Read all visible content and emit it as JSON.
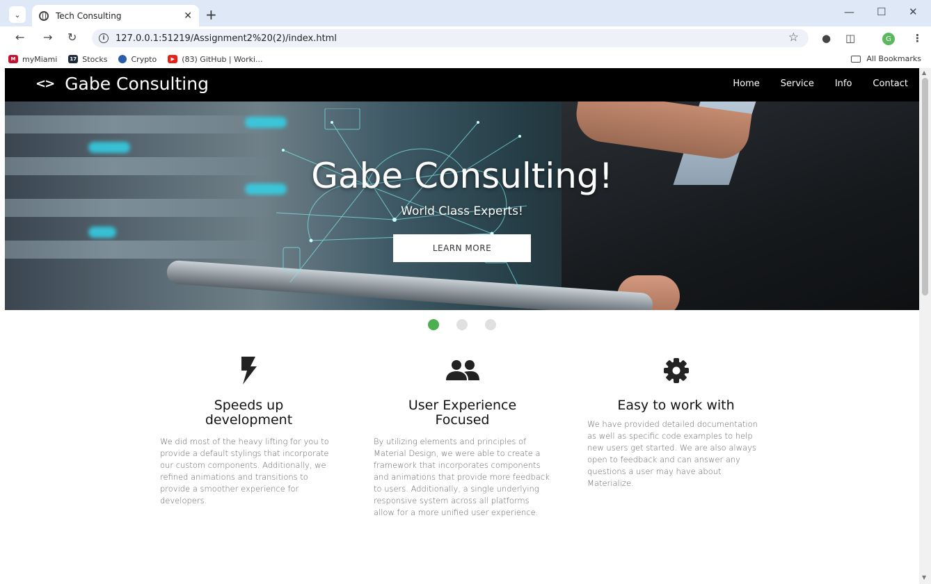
{
  "browser": {
    "tab_title": "Tech Consulting",
    "url": "127.0.0.1:51219/Assignment2%20(2)/index.html",
    "profile_initial": "G",
    "bookmarks": [
      {
        "label": "myMiami",
        "icon": "miami-icon",
        "color": "#c41230"
      },
      {
        "label": "Stocks",
        "icon": "stocks-icon",
        "color": "#1e2a3a"
      },
      {
        "label": "Crypto",
        "icon": "crypto-icon",
        "color": "#2a5caa"
      },
      {
        "label": "(83) GitHub | Worki...",
        "icon": "youtube-icon",
        "color": "#e62117"
      }
    ],
    "all_bookmarks": "All Bookmarks"
  },
  "site": {
    "brand_icon": "<>",
    "brand": "Gabe Consulting",
    "nav": [
      "Home",
      "Service",
      "Info",
      "Contact"
    ]
  },
  "hero": {
    "title": "Gabe Consulting!",
    "subtitle": "World Class Experts!",
    "button": "LEARN MORE",
    "slides": 3,
    "active_slide": 1,
    "accent_color": "#4caf50"
  },
  "features": [
    {
      "icon": "bolt-icon",
      "title_line1": "Speeds up",
      "title_line2": "development",
      "text": "We did most of the heavy lifting for you to provide a default stylings that incorporate our custom components. Additionally, we refined animations and transitions to provide a smoother experience for developers."
    },
    {
      "icon": "group-icon",
      "title_line1": "User Experience",
      "title_line2": "Focused",
      "text": "By utilizing elements and principles of Material Design, we were able to create a framework that incorporates components and animations that provide more feedback to users. Additionally, a single underlying responsive system across all platforms allow for a more unified user experience."
    },
    {
      "icon": "gear-icon",
      "title_line1": "Easy to work with",
      "title_line2": "",
      "text": "We have provided detailed documentation as well as specific code examples to help new users get started. We are also always open to feedback and can answer any questions a user may have about Materialize."
    }
  ]
}
